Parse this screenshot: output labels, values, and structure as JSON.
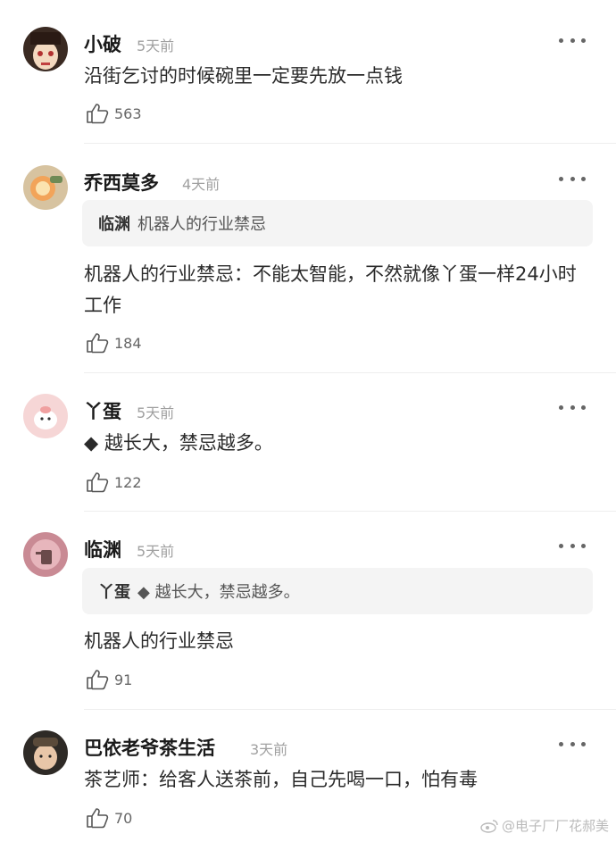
{
  "comments": [
    {
      "name": "小破",
      "time": "5天前",
      "text": "沿街乞讨的时候碗里一定要先放一点钱",
      "likes": "563"
    },
    {
      "name": "乔西莫多",
      "time": "4天前",
      "quote_name": "临渊",
      "quote_text": "机器人的行业禁忌",
      "text": "机器人的行业禁忌：不能太智能，不然就像丫蛋一样24小时工作",
      "likes": "184"
    },
    {
      "name": "丫蛋",
      "time": "5天前",
      "text": "◆ 越长大，禁忌越多。",
      "likes": "122"
    },
    {
      "name": "临渊",
      "time": "5天前",
      "quote_name": "丫蛋",
      "quote_text": "◆ 越长大，禁忌越多。",
      "text": "机器人的行业禁忌",
      "likes": "91"
    },
    {
      "name": "巴依老爷茶生活",
      "time": "3天前",
      "text": "茶艺师：给客人送茶前，自己先喝一口，怕有毒",
      "likes": "70"
    }
  ],
  "watermark": "@电子厂厂花郝美",
  "colors": {
    "background": "#ffffff",
    "quote_bg": "#f4f4f4",
    "time": "#a0a0a0",
    "divider": "#eeeeee"
  }
}
